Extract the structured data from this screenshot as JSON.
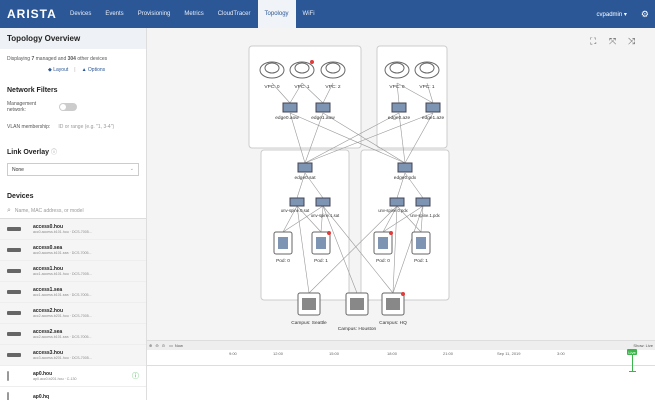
{
  "topbar": {
    "brand": "ARISTA",
    "nav": [
      "Devices",
      "Events",
      "Provisioning",
      "Metrics",
      "CloudTracer",
      "Topology",
      "WiFi"
    ],
    "active": "Topology",
    "user": "cvpadmin"
  },
  "sidebar": {
    "title": "Topology Overview",
    "displaying_prefix": "Displaying",
    "managed_count": "7",
    "managed_mid": "managed and",
    "other_count": "304",
    "other_suffix": "other devices",
    "layout_label": "Layout",
    "options_label": "Options",
    "filters_title": "Network Filters",
    "mgmt_label": "Management network:",
    "vlan_label": "VLAN membership:",
    "vlan_placeholder": "ID or range (e.g. \"1, 3-4\")",
    "link_overlay_title": "Link Overlay",
    "overlay_value": "None",
    "devices_title": "Devices",
    "search_placeholder": "Name, MAC address, or model",
    "devices": [
      {
        "name": "access0.hou",
        "sub": "acc0.access.b101.hou · DCS-7005..."
      },
      {
        "name": "access0.sea",
        "sub": "acc0.access.b101.sea · DCS-7005..."
      },
      {
        "name": "access1.hou",
        "sub": "acc1.access.b101.hou · DCS-7005..."
      },
      {
        "name": "access1.sea",
        "sub": "acc1.access.b101.sea · DCS-7005..."
      },
      {
        "name": "access2.hou",
        "sub": "acc2.access.b201.hou · DCS-7005..."
      },
      {
        "name": "access2.sea",
        "sub": "acc2.access.b101.sea · DCS-7005..."
      },
      {
        "name": "access3.hou",
        "sub": "acc3.access.b201.hou · DCS-7005..."
      },
      {
        "name": "ap0.hou",
        "sub": "ap0.acc0.b201.hou · C-130"
      },
      {
        "name": "ap0.hq",
        "sub": ""
      }
    ]
  },
  "topology": {
    "vpc_left": [
      "VPC: 0",
      "VPC: 1",
      "VPC: 2"
    ],
    "vpc_right": [
      "VPC: 0",
      "VPC: 1"
    ],
    "edges": [
      "edge0.aow",
      "edge1.aow",
      "edge0.aze",
      "edge1.aze"
    ],
    "cores": [
      "edge0.sat",
      "edge0.pdx"
    ],
    "spines": [
      "unv-spine.0.sat",
      "unv-spine.1.sat",
      "unv-spine.0.pdx",
      "unv-spine.1.pdx"
    ],
    "pods": [
      "Pod: 0",
      "Pod: 1",
      "Pod: 0",
      "Pod: 1"
    ],
    "campuses": [
      "Campus: Seattle",
      "Campus: Houston",
      "Campus: HQ"
    ]
  },
  "timeline": {
    "now_label": "Now",
    "show_label": "Show: Live",
    "live_label": "Live",
    "ticks": [
      "9:00",
      "12:00",
      "15:00",
      "18:00",
      "21:00",
      "Sep 11, 2019",
      "3:00"
    ]
  },
  "colors": {
    "topbar": "#2b5797",
    "live": "#3bb54a",
    "alert": "#e03c3c"
  }
}
